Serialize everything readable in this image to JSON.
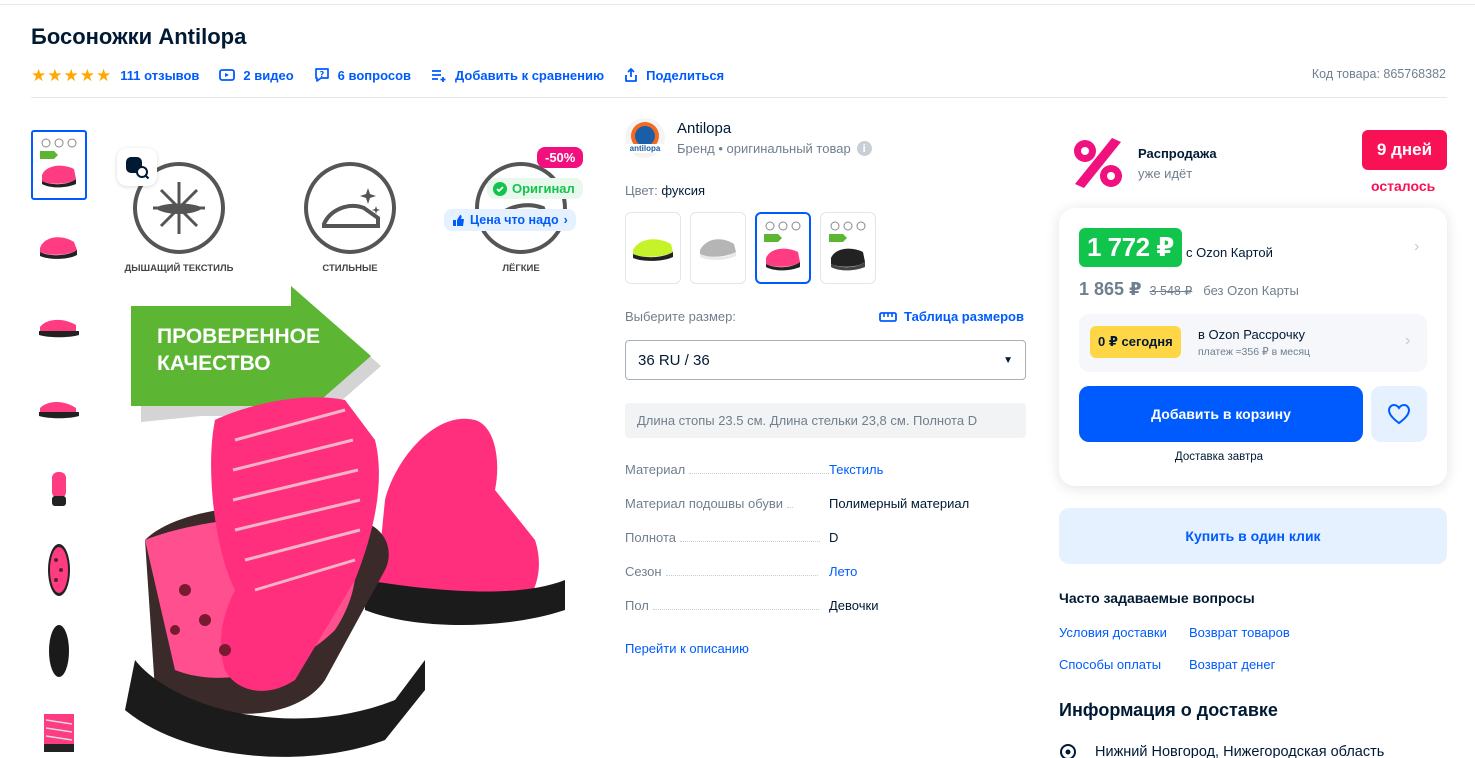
{
  "product": {
    "title": "Босоножки Antilopa",
    "sku_label": "Код товара: 865768382",
    "rating_stars": 5
  },
  "meta_links": {
    "reviews": "111 отзывов",
    "videos": "2 видео",
    "questions": "6 вопросов",
    "compare": "Добавить к сравнению",
    "share": "Поделиться"
  },
  "gallery": {
    "thumbnail_count": 8,
    "active_index": 0,
    "badges": {
      "discount": "-50%",
      "original": "Оригинал",
      "fair_price": "Цена что надо"
    },
    "features": [
      "ДЫШАЩИЙ ТЕКСТИЛЬ",
      "СТИЛЬНЫЕ",
      "ЛЁГКИЕ"
    ],
    "banner_line1": "ПРОВЕРЕННОЕ",
    "banner_line2": "КАЧЕСТВО"
  },
  "brand": {
    "name": "Antilopa",
    "subtitle": "Бренд • оригинальный товар",
    "logo_text": "antilopa"
  },
  "color": {
    "label": "Цвет:",
    "value": "фуксия",
    "swatches": [
      "lime",
      "grey",
      "fuchsia",
      "black"
    ],
    "active_index": 2
  },
  "size": {
    "label": "Выберите размер:",
    "table_link": "Таблица размеров",
    "selected": "36 RU / 36",
    "info": "Длина стопы 23.5 см. Длина стельки 23,8 см. Полнота D"
  },
  "specs": [
    {
      "key": "Материал",
      "value": "Текстиль",
      "link": true
    },
    {
      "key": "Материал подошвы обуви",
      "value": "Полимерный материал",
      "link": false
    },
    {
      "key": "Полнота",
      "value": "D",
      "link": false
    },
    {
      "key": "Сезон",
      "value": "Лето",
      "link": true
    },
    {
      "key": "Пол",
      "value": "Девочки",
      "link": false
    }
  ],
  "to_description": "Перейти к описанию",
  "sale": {
    "title": "Распродажа",
    "subtitle": "уже идёт",
    "days": "9 дней",
    "days_suffix": "осталось"
  },
  "price": {
    "card_price": "1 772 ₽",
    "card_label": "с Ozon Картой",
    "regular_price": "1 865 ₽",
    "old_price": "3 548 ₽",
    "regular_label": "без Ozon Карты"
  },
  "installment": {
    "badge": "0 ₽ сегодня",
    "title": "в Ozon Рассрочку",
    "subtitle": "платеж ≈356 ₽ в месяц"
  },
  "actions": {
    "add_to_cart": "Добавить в корзину",
    "delivery": "Доставка завтра",
    "buy_one_click": "Купить в один клик"
  },
  "faq": {
    "title": "Часто задаваемые вопросы",
    "links": [
      "Условия доставки",
      "Возврат товаров",
      "Способы оплаты",
      "Возврат денег"
    ]
  },
  "delivery_info": {
    "title": "Информация о доставке",
    "city": "Нижний Новгород, Нижегородская область"
  },
  "colors": {
    "accent": "#005bff",
    "price_green": "#10c44c",
    "sale_red": "#f91155",
    "star": "#ffa800",
    "installment_yellow": "#ffd645"
  }
}
